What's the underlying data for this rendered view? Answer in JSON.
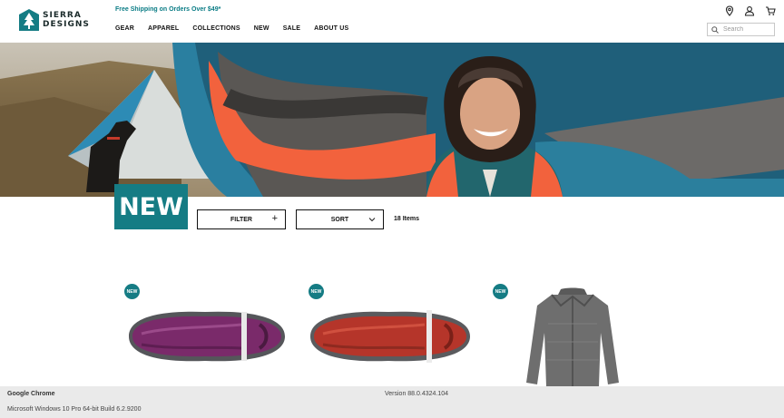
{
  "brand": {
    "line1": "SIERRA",
    "line2": "DESIGNS"
  },
  "promo": "Free Shipping on Orders Over $49*",
  "nav": [
    "GEAR",
    "APPAREL",
    "COLLECTIONS",
    "NEW",
    "SALE",
    "ABOUT US"
  ],
  "utilities": [
    "location-pin-icon",
    "account-icon",
    "cart-icon"
  ],
  "search": {
    "placeholder": "Search"
  },
  "colors": {
    "accent": "#157c84",
    "promo": "#0a7c85"
  },
  "page": {
    "title": "NEW"
  },
  "toolbar": {
    "filter_label": "FILTER",
    "filter_symbol": "+",
    "sort_label": "SORT",
    "item_count": "18 Items"
  },
  "products": [
    {
      "badge": "NEW",
      "kind": "sleeping bag",
      "color": "#7a2a6a"
    },
    {
      "badge": "NEW",
      "kind": "sleeping bag",
      "color": "#b5352a"
    },
    {
      "badge": "NEW",
      "kind": "jacket",
      "color": "#6e6e6e"
    }
  ],
  "statusbar": {
    "app": "Google Chrome",
    "version": "Version 88.0.4324.104",
    "os": "Microsoft Windows 10 Pro 64-bit Build 6.2.9200"
  }
}
